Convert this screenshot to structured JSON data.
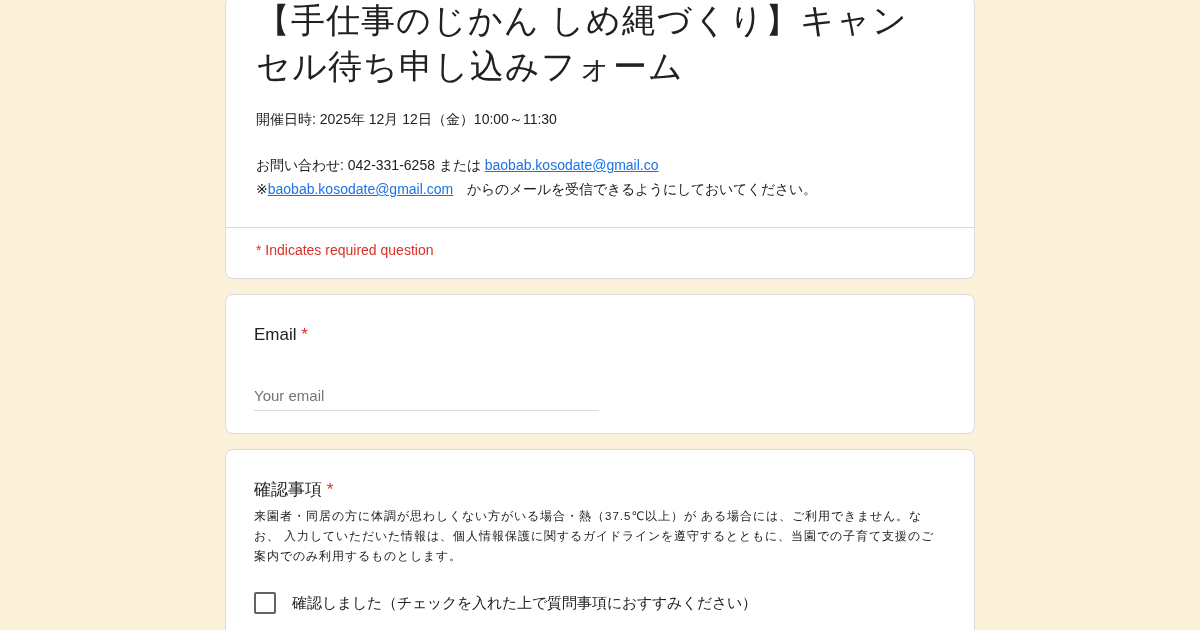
{
  "header": {
    "title": "【手仕事のじかん しめ縄づくり】キャンセル待ち申し込みフォーム",
    "date_line": "開催日時: 2025年 12月 12日（金）10:00～11:30",
    "contact_prefix": "お問い合わせ: 042-331-6258 または ",
    "contact_link": "baobab.kosodate@gmail.co",
    "note_prefix": "※",
    "note_link": "baobab.kosodate@gmail.com",
    "note_suffix": "　からのメールを受信できるようにしておいてください。",
    "required_note": "* Indicates required question",
    "required_mark": "*"
  },
  "questions": [
    {
      "kind": "text",
      "title": "Email",
      "required": true,
      "placeholder": "Your email"
    },
    {
      "kind": "checkbox",
      "title": "確認事項",
      "required": true,
      "description": "来園者・同居の方に体調が思わしくない方がいる場合・熱（37.5℃以上）が ある場合には、ご利用できません。なお、 入力していただいた情報は、個人情報保護に関するガイドラインを遵守するとともに、当園での子育て支援のご案内でのみ利用するものとします。",
      "options": [
        {
          "label": "確認しました（チェックを入れた上で質問事項におすすみください）",
          "checked": false
        }
      ]
    }
  ]
}
